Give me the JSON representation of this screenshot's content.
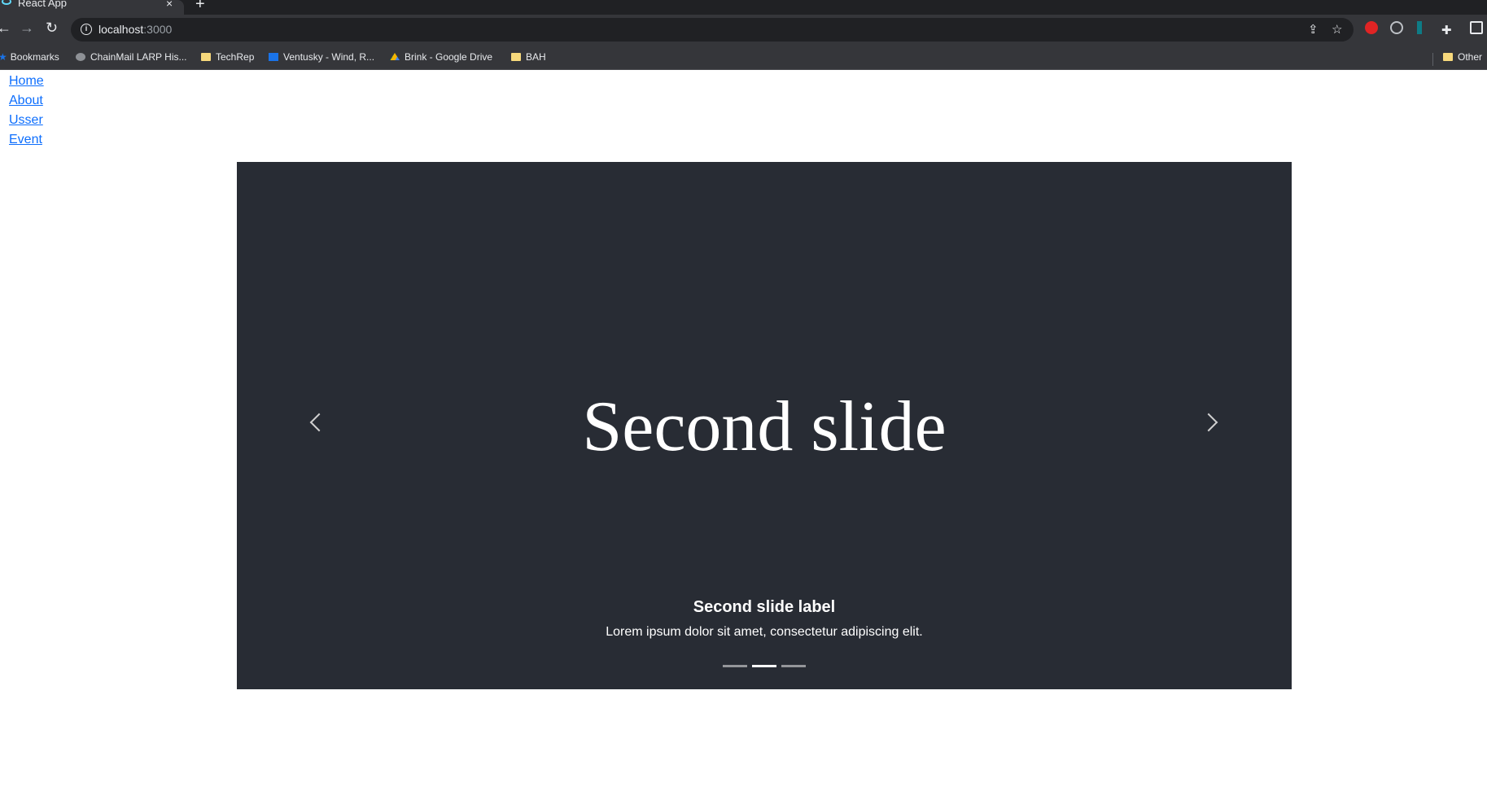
{
  "browser": {
    "tab_title": "React App",
    "tab_close": "×",
    "new_tab": "+",
    "url_host": "localhost",
    "url_port": ":3000",
    "bookmarks": [
      {
        "label": "Bookmarks",
        "icon": "star-icon"
      },
      {
        "label": "ChainMail LARP His...",
        "icon": "globe-icon"
      },
      {
        "label": "TechRep",
        "icon": "folder-icon"
      },
      {
        "label": "Ventusky - Wind, R...",
        "icon": "ventusky-icon"
      },
      {
        "label": "Brink - Google Drive",
        "icon": "google-drive-icon"
      },
      {
        "label": "BAH",
        "icon": "folder-icon"
      },
      {
        "label": "Other",
        "icon": "folder-icon"
      }
    ]
  },
  "nav": {
    "links": [
      "Home",
      "About",
      "Usser",
      "Event"
    ]
  },
  "carousel": {
    "slide_text": "Second slide",
    "caption_title": "Second slide label",
    "caption_text": "Lorem ipsum dolor sit amet, consectetur adipiscing elit.",
    "indicator_count": 3,
    "active_index": 1,
    "background": "#282c34"
  }
}
